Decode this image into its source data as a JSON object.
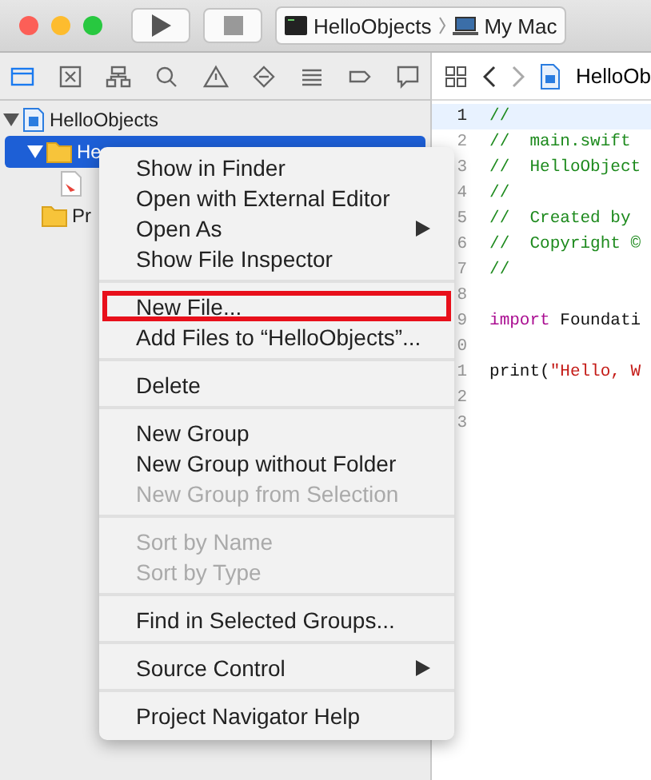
{
  "toolbar": {
    "scheme": {
      "target": "HelloObjects",
      "destination": "My Mac"
    }
  },
  "navigator": {
    "tabs": [
      {
        "kind": "folder",
        "selected": true
      },
      {
        "kind": "symbol",
        "selected": false
      },
      {
        "kind": "hierarchy",
        "selected": false
      },
      {
        "kind": "search",
        "selected": false
      },
      {
        "kind": "warning",
        "selected": false
      },
      {
        "kind": "test",
        "selected": false
      },
      {
        "kind": "debug",
        "selected": false
      },
      {
        "kind": "breakpoint",
        "selected": false
      },
      {
        "kind": "report",
        "selected": false
      }
    ],
    "tree": [
      {
        "kind": "project",
        "label": "HelloObjects",
        "expanded": true,
        "selected": false,
        "children": [
          {
            "kind": "folder",
            "label": "He",
            "expanded": true,
            "selected": true,
            "children": [
              {
                "kind": "swift",
                "selected": false
              }
            ]
          },
          {
            "kind": "folder",
            "label": "Pr",
            "expanded": false,
            "selected": false
          }
        ]
      }
    ]
  },
  "editor": {
    "breadcrumb": "HelloOb",
    "lines": [
      {
        "number": "1",
        "current": true,
        "code": [
          {
            "kind": "comment",
            "text": "//"
          }
        ]
      },
      {
        "number": "2",
        "current": false,
        "code": [
          {
            "kind": "comment",
            "text": "//  main.swift"
          }
        ]
      },
      {
        "number": "3",
        "current": false,
        "code": [
          {
            "kind": "comment",
            "text": "//  HelloObject"
          }
        ]
      },
      {
        "number": "4",
        "current": false,
        "code": [
          {
            "kind": "comment",
            "text": "//"
          }
        ]
      },
      {
        "number": "5",
        "current": false,
        "code": [
          {
            "kind": "comment",
            "text": "//  Created by"
          }
        ]
      },
      {
        "number": "6",
        "current": false,
        "code": [
          {
            "kind": "comment",
            "text": "//  Copyright ©"
          }
        ]
      },
      {
        "number": "7",
        "current": false,
        "code": [
          {
            "kind": "comment",
            "text": "//"
          }
        ]
      },
      {
        "number": "8",
        "current": false
      },
      {
        "number": "9",
        "current": false,
        "code": [
          {
            "kind": "keyword",
            "text": "import"
          },
          {
            "kind": "plain",
            "text": " Foundati"
          }
        ]
      },
      {
        "number": "0",
        "current": false
      },
      {
        "number": "1",
        "current": false,
        "code": [
          {
            "kind": "plain",
            "text": "print("
          },
          {
            "kind": "string",
            "text": "\"Hello, W"
          }
        ]
      },
      {
        "number": "2",
        "current": false
      },
      {
        "number": "3",
        "current": false
      }
    ]
  },
  "context_menu": {
    "items": [
      {
        "kind": "item",
        "label": "Show in Finder",
        "disabled": false,
        "submenu": false,
        "outlined": false
      },
      {
        "kind": "item",
        "label": "Open with External Editor",
        "disabled": false,
        "submenu": false,
        "outlined": false
      },
      {
        "kind": "item",
        "label": "Open As",
        "disabled": false,
        "submenu": true,
        "outlined": false
      },
      {
        "kind": "item",
        "label": "Show File Inspector",
        "disabled": false,
        "submenu": false,
        "outlined": false
      },
      {
        "kind": "separator"
      },
      {
        "kind": "item",
        "label": "New File...",
        "disabled": false,
        "submenu": false,
        "outlined": true
      },
      {
        "kind": "item",
        "label": "Add Files to “HelloObjects”...",
        "disabled": false,
        "submenu": false,
        "outlined": false
      },
      {
        "kind": "separator"
      },
      {
        "kind": "item",
        "label": "Delete",
        "disabled": false,
        "submenu": false,
        "outlined": false
      },
      {
        "kind": "separator"
      },
      {
        "kind": "item",
        "label": "New Group",
        "disabled": false,
        "submenu": false,
        "outlined": false
      },
      {
        "kind": "item",
        "label": "New Group without Folder",
        "disabled": false,
        "submenu": false,
        "outlined": false
      },
      {
        "kind": "item",
        "label": "New Group from Selection",
        "disabled": true,
        "submenu": false,
        "outlined": false
      },
      {
        "kind": "separator"
      },
      {
        "kind": "item",
        "label": "Sort by Name",
        "disabled": true,
        "submenu": false,
        "outlined": false
      },
      {
        "kind": "item",
        "label": "Sort by Type",
        "disabled": true,
        "submenu": false,
        "outlined": false
      },
      {
        "kind": "separator"
      },
      {
        "kind": "item",
        "label": "Find in Selected Groups...",
        "disabled": false,
        "submenu": false,
        "outlined": false
      },
      {
        "kind": "separator"
      },
      {
        "kind": "item",
        "label": "Source Control",
        "disabled": false,
        "submenu": true,
        "outlined": false
      },
      {
        "kind": "separator"
      },
      {
        "kind": "item",
        "label": "Project Navigator Help",
        "disabled": false,
        "submenu": false,
        "outlined": false
      }
    ]
  }
}
